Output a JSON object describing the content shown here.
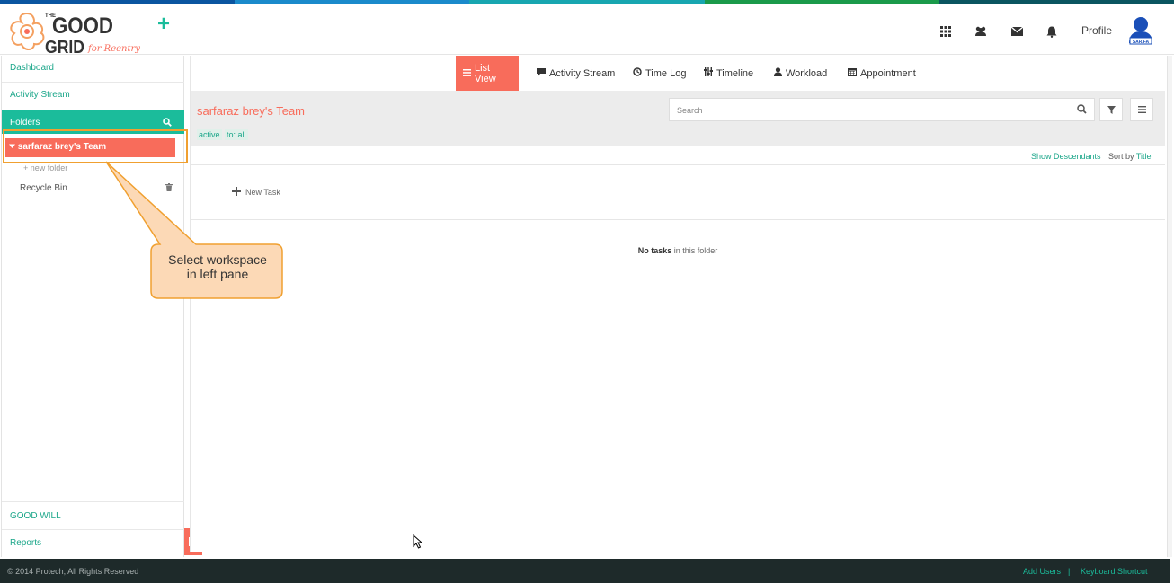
{
  "colors": {
    "accent": "#1bbc9b",
    "coral": "#f86c5b",
    "footer_bg": "#1e2a2a",
    "callout_fill": "#fcd9b6",
    "callout_border": "#f0a030"
  },
  "stripe_colors": [
    "#0a55a0",
    "#1a8acb",
    "#18a6b0",
    "#1a9a4a",
    "#0a5560"
  ],
  "header": {
    "logo": {
      "line1": "GOOD",
      "line2": "GRID",
      "prefix": "THE",
      "script": "for Reentry"
    },
    "plus_label": "+",
    "icons": [
      "grid-icon",
      "users-icon",
      "mail-icon",
      "bell-icon"
    ],
    "profile_label": "Profile",
    "avatar_text": "SAR.FA"
  },
  "sidebar": {
    "dashboard": "Dashboard",
    "activity_stream": "Activity Stream",
    "folders": "Folders",
    "team": "sarfaraz brey's Team",
    "new_folder": "+ new folder",
    "recycle_bin": "Recycle Bin",
    "good_will": "GOOD WILL",
    "reports": "Reports"
  },
  "tabs": {
    "list_view": "List View",
    "activity_stream": "Activity Stream",
    "time_log": "Time Log",
    "timeline": "Timeline",
    "workload": "Workload",
    "appointment": "Appointment"
  },
  "subheader": {
    "title": "sarfaraz brey's Team",
    "tag_active": "active",
    "tag_to": "to: all",
    "search_placeholder": "Search"
  },
  "options": {
    "show_descendants": "Show Descendants",
    "sort_by": "Sort by",
    "sort_field": "Title"
  },
  "tasks": {
    "new_task": "New Task",
    "empty_bold": "No tasks",
    "empty_rest": " in this folder"
  },
  "callout": {
    "line1": "Select workspace",
    "line2": "in left pane"
  },
  "footer": {
    "copyright": "© 2014 Protech, All Rights Reserved",
    "add_users": "Add Users",
    "separator": "|",
    "keyboard_shortcut": "Keyboard Shortcut"
  }
}
